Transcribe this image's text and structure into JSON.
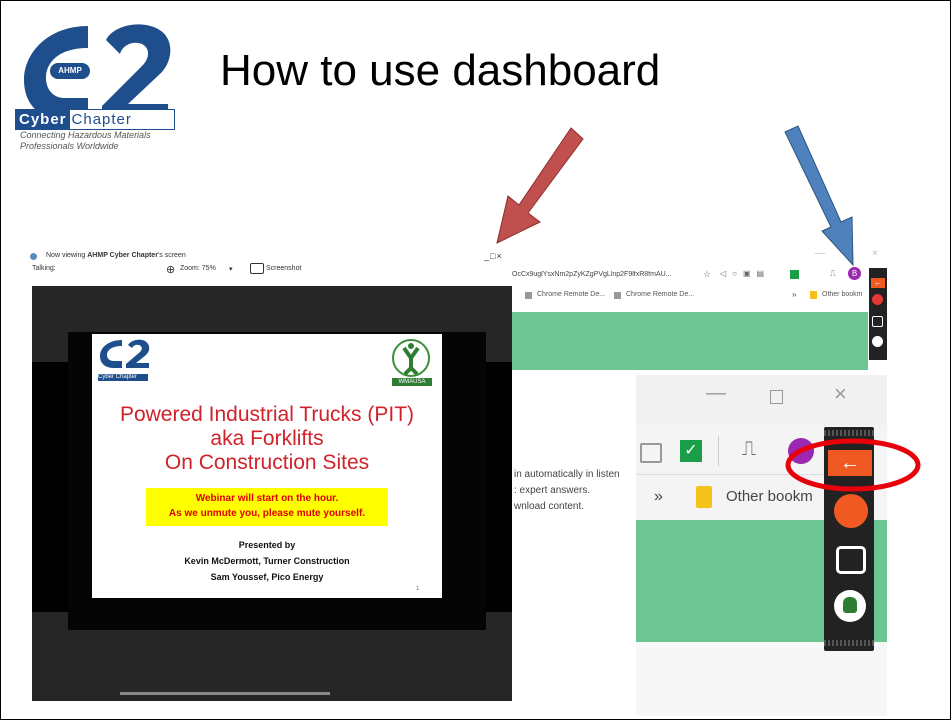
{
  "slide": {
    "title": "How to use dashboard",
    "logo": {
      "badge": "AHMP",
      "cyber": "Cyber",
      "chapter": "Chapter",
      "tagline": "Connecting Hazardous Materials Professionals Worldwide"
    }
  },
  "share_window": {
    "viewing_prefix": "Now viewing ",
    "viewing_name": "AHMP Cyber Chapter",
    "viewing_suffix": "'s screen",
    "talking_label": "Talking:",
    "zoom_label": "Zoom: 75%",
    "screenshot_label": "Screenshot",
    "controls": "_□×"
  },
  "inner_slide": {
    "logo_text": "Cyber Chapter",
    "wmausa": "WMAUSA",
    "headline_1": "Powered Industrial Trucks (PIT)",
    "headline_2": "aka Forklifts",
    "headline_3": "On Construction Sites",
    "notice_1": "Webinar will start on the hour.",
    "notice_2": "As we unmute you, please mute yourself.",
    "presented_by": "Presented by",
    "presenter_1": "Kevin McDermott, Turner Construction",
    "presenter_2": "Sam Youssef, Pico Energy",
    "page_number": "1"
  },
  "browser": {
    "url_fragment": "OcCx9uglYsxNm2pZyKZgPVgLlnp2F9lfxR8fmAU...",
    "bookmark_1": "Chrome Remote De...",
    "bookmark_2": "Chrome Remote De...",
    "bookmark_more": "»",
    "bookmark_other": "Other bookm",
    "profile_initial": "B",
    "side_text_1": "in automatically in listen",
    "side_text_2": ": expert answers.",
    "side_text_3": "wnload content."
  },
  "zoomed": {
    "more": "»",
    "other_bookmarks": "Other bookm"
  },
  "colors": {
    "red_arrow": "#c0504d",
    "blue_arrow": "#4f81bd",
    "highlight_ellipse": "#e8000b",
    "toolbar_orange": "#f05a22",
    "green_band": "#6cc592"
  }
}
